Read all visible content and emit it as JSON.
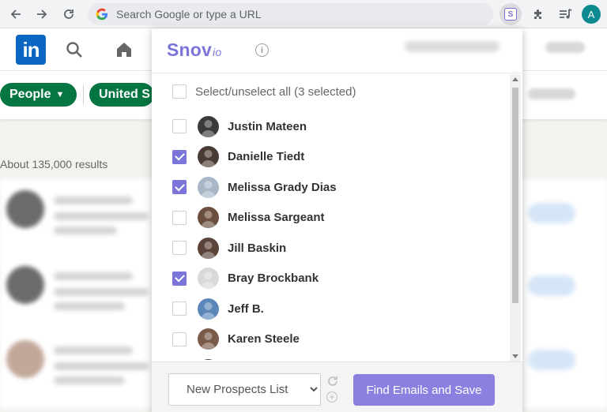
{
  "browser": {
    "omnibox_placeholder": "Search Google or type a URL",
    "snov_extension_letter": "S",
    "profile_initial": "A"
  },
  "linkedin": {
    "logo_text": "in",
    "filters": {
      "people_label": "People",
      "country_label": "United S"
    },
    "results_text": "About 135,000 results"
  },
  "popup": {
    "brand_name": "Snov",
    "brand_suffix": "io",
    "info_glyph": "i",
    "select_all_label": "Select/unselect all (3 selected)",
    "prospects": [
      {
        "name": "Justin Mateen",
        "checked": false,
        "avatar_color": "#3a3a3a"
      },
      {
        "name": "Danielle Tiedt",
        "checked": true,
        "avatar_color": "#4a3c34"
      },
      {
        "name": "Melissa Grady Dias",
        "checked": true,
        "avatar_color": "#a9b6c6"
      },
      {
        "name": "Melissa Sargeant",
        "checked": false,
        "avatar_color": "#6a4f3e"
      },
      {
        "name": "Jill Baskin",
        "checked": false,
        "avatar_color": "#5a4338"
      },
      {
        "name": "Bray Brockbank",
        "checked": true,
        "avatar_color": "#d9d9d9"
      },
      {
        "name": "Jeff B.",
        "checked": false,
        "avatar_color": "#5b87b8"
      },
      {
        "name": "Karen Steele",
        "checked": false,
        "avatar_color": "#7a5a48"
      },
      {
        "name": "",
        "checked": false,
        "avatar_color": "#444444"
      }
    ],
    "footer": {
      "list_select_value": "New Prospects List",
      "find_button_label": "Find Emails and Save"
    }
  },
  "colors": {
    "snov_purple": "#7b74d9",
    "button_purple": "#8b80e0",
    "linkedin_blue": "#0a66c2",
    "linkedin_green": "#057642"
  }
}
